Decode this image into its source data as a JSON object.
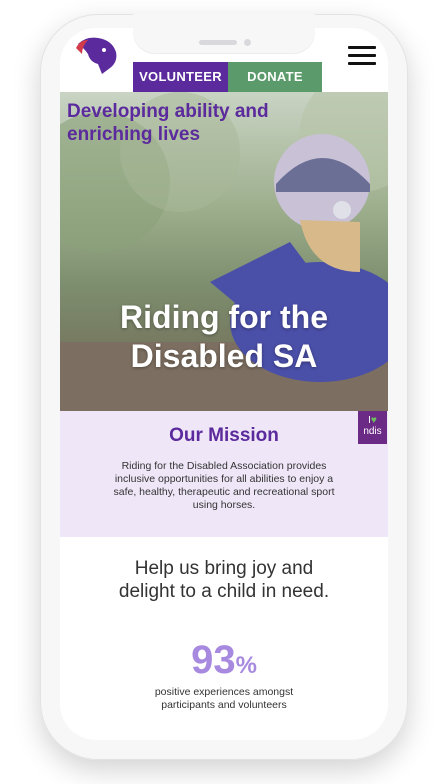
{
  "header": {
    "volunteer_label": "VOLUNTEER",
    "donate_label": "DONATE"
  },
  "icons": {
    "logo": "horse-head-logo-icon",
    "menu": "hamburger-menu-icon",
    "ndis": "ndis-badge-icon"
  },
  "hero": {
    "tagline": "Developing ability and enriching lives",
    "title_line1": "Riding for the",
    "title_line2": "Disabled SA"
  },
  "ndis": {
    "line1": "I",
    "line2": "ndis"
  },
  "mission": {
    "title": "Our Mission",
    "text": "Riding for the Disabled Association provides inclusive opportunities for all abilities to enjoy a safe, healthy, therapeutic and recreational sport using horses."
  },
  "help": {
    "text": "Help us bring joy and delight to a child in need."
  },
  "stat": {
    "number": "93",
    "suffix": "%",
    "text": "positive experiences amongst participants and volunteers"
  },
  "colors": {
    "brand_purple": "#5b2a9c",
    "donate_green": "#5b9a6a",
    "mission_bg": "#efe7f8",
    "stat_purple": "#a78adf"
  }
}
